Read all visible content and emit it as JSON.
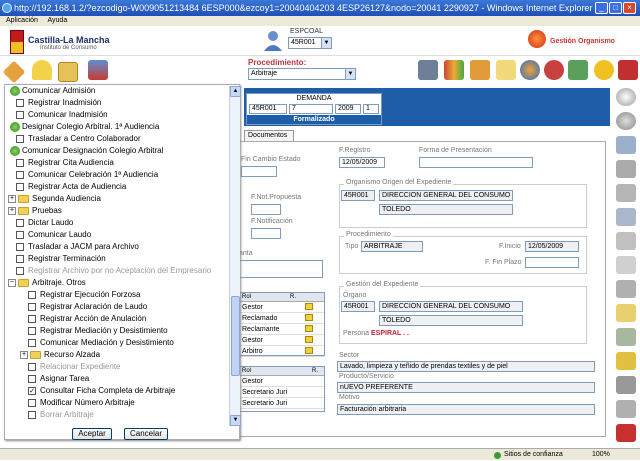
{
  "window": {
    "title": "http://192.168.1.2/?ezcodigo-W009051213484 6ESP000&ezcoy1=20040404203 4ESP26127&nodo=20041 2290927 - Windows Internet Explorer"
  },
  "menu": [
    "Aplicación",
    "Ayuda"
  ],
  "header": {
    "logo_name": "Castilla-La Mancha",
    "logo_sub": "Instituto de Consumo",
    "user_label": "ESPCOAL",
    "user_value": "45R001",
    "org_link": "Gestión Organismo"
  },
  "procedure": {
    "label": "Procedimiento:",
    "value": "Arbitraje"
  },
  "demanda": {
    "title": "DEMANDA",
    "cells": [
      "45R001",
      "7",
      "2009",
      "1"
    ],
    "status": "Formalizado"
  },
  "tabs": {
    "documentos": "Documentos"
  },
  "form": {
    "fin_cambio_estado": "Fin Cambio Estado",
    "f_registro_label": "F.Registro",
    "f_registro": "12/05/2009",
    "forma_presentacion": "Forma de Presentación",
    "f_not_propuesta": "F.Not.Propuesta",
    "f_notificacion": "F.Notificación",
    "organismo_title": "Organismo Origen del Expediente",
    "org_code": "45R001",
    "org_name": "DIRECCION GENERAL DEL CONSUMO",
    "org_city": "TOLEDO",
    "procedimiento_title": "Procedimiento",
    "tipo_label": "Tipo",
    "tipo": "ARBITRAJE",
    "f_inicio_label": "F.Inicio",
    "f_inicio": "12/05/2009",
    "f_fin_plazo_label": "F. Fin Plazo",
    "gestion_title": "Gestión del Expediente",
    "organo_label": "Órgano",
    "organo_code": "45R001",
    "organo_name": "DIRECCION GENERAL DEL CONSUMO",
    "organo_city": "TOLEDO",
    "persona_label": "Persona",
    "persona": "ESPIRAL . .",
    "sector_label": "Sector",
    "sector": "Lavado, limpieza y teñido de prendas textiles y de piel",
    "producto_label": "Producto/Servicio",
    "producto": "nUEVO PREFERENTE",
    "motivo_label": "Motivo",
    "motivo": "Facturación arbitraria",
    "anta_label": "anta"
  },
  "roles_table": {
    "headers": [
      "Rol",
      "R."
    ],
    "rows": [
      "Gestor",
      "Reclamado",
      "Reclamante",
      "Gestor",
      "Arbitro"
    ]
  },
  "roles_table2": {
    "headers": [
      "Rol",
      "R."
    ],
    "rows": [
      "Gestor",
      "Secretario Juri",
      "Secretario Juri"
    ]
  },
  "tree": {
    "items": [
      {
        "label": "Comunicar Admisión",
        "kind": "green"
      },
      {
        "label": "Registrar Inadmisión",
        "kind": "cb"
      },
      {
        "label": "Comunicar Inadmisión",
        "kind": "cb"
      },
      {
        "label": "Designar Colegio Arbitral. 1ª Audiencia",
        "kind": "green"
      },
      {
        "label": "Trasladar a Centro Colaborador",
        "kind": "cb"
      },
      {
        "label": "Comunicar Designación Colegio Arbitral",
        "kind": "green"
      },
      {
        "label": "Registrar Cita Audiencia",
        "kind": "cb"
      },
      {
        "label": "Comunicar Celebración 1ª Audiencia",
        "kind": "cb"
      },
      {
        "label": "Registrar Acta de Audiencia",
        "kind": "cb"
      },
      {
        "label": "Segunda Audiencia",
        "kind": "folder"
      },
      {
        "label": "Pruebas",
        "kind": "folder"
      },
      {
        "label": "Dictar Laudo",
        "kind": "cb"
      },
      {
        "label": "Comunicar Laudo",
        "kind": "cb"
      },
      {
        "label": "Trasladar a JACM para Archivo",
        "kind": "cb"
      },
      {
        "label": "Registrar Terminación",
        "kind": "cb"
      },
      {
        "label": "Registrar Archivo por no Aceptación del Empresario",
        "kind": "cb-disabled"
      },
      {
        "label": "Arbitraje. Otros",
        "kind": "folder-open"
      },
      {
        "label": "Registrar Ejecución Forzosa",
        "kind": "cb2"
      },
      {
        "label": "Registrar Aclaración de Laudo",
        "kind": "cb2"
      },
      {
        "label": "Registrar Acción de Anulación",
        "kind": "cb2"
      },
      {
        "label": "Registrar Mediación y Desistimiento",
        "kind": "cb2"
      },
      {
        "label": "Comunicar Mediación y Desistimiento",
        "kind": "cb2"
      },
      {
        "label": "Recurso Alzada",
        "kind": "folder2"
      },
      {
        "label": "Relacionar Expediente",
        "kind": "cb2-disabled"
      },
      {
        "label": "Asignar Tarea",
        "kind": "cb2"
      },
      {
        "label": "Consultar Ficha Completa de Arbitraje",
        "kind": "cb2-checked"
      },
      {
        "label": "Modificar Número Arbitraje",
        "kind": "cb2"
      },
      {
        "label": "Borrar Arbitraje",
        "kind": "cb2-disabled"
      }
    ],
    "accept": "Aceptar",
    "cancel": "Cancelar"
  },
  "status": {
    "zone": "Sitios de confianza",
    "zoom": "100%"
  },
  "colors": {
    "title_bar": "#1f4fb8",
    "panel_blue": "#1e5ea8",
    "accent_red": "#b33344"
  }
}
